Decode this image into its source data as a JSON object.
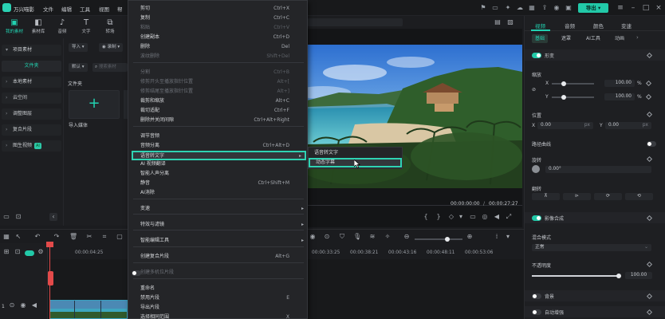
{
  "titlebar": {
    "app_name": "万兴喵影",
    "menus": [
      "文件",
      "编辑",
      "工具",
      "视图",
      "帮"
    ],
    "export_label": "导出"
  },
  "left_panel": {
    "tabs": [
      {
        "label": "我的素材",
        "icon": "media-icon"
      },
      {
        "label": "素材库",
        "icon": "library-icon"
      },
      {
        "label": "音频",
        "icon": "music-icon"
      },
      {
        "label": "文字",
        "icon": "text-icon"
      },
      {
        "label": "转场",
        "icon": "transition-icon"
      }
    ],
    "sidebar": [
      {
        "label": "项目素材",
        "kind": "section"
      },
      {
        "label": "文件夹",
        "kind": "folder"
      },
      {
        "label": "本地素材",
        "kind": "section"
      },
      {
        "label": "云空间",
        "kind": "section"
      },
      {
        "label": "调整图层",
        "kind": "section"
      },
      {
        "label": "复合片段",
        "kind": "section"
      },
      {
        "label": "图生视频",
        "kind": "section",
        "badge": "AI"
      }
    ],
    "import_button": "导入",
    "record_button": "录制",
    "sort_label": "默认",
    "search_placeholder": "搜索素材",
    "folder_title": "文件夹",
    "import_tile_label": "导入媒体"
  },
  "context_menu": {
    "items": [
      {
        "label": "剪切",
        "shortcut": "Ctrl+X",
        "disabled": false
      },
      {
        "label": "复制",
        "shortcut": "Ctrl+C",
        "disabled": false
      },
      {
        "label": "粘贴",
        "shortcut": "Ctrl+V",
        "disabled": true
      },
      {
        "label": "创建副本",
        "shortcut": "Ctrl+D",
        "disabled": false
      },
      {
        "label": "删除",
        "shortcut": "Del",
        "disabled": false
      },
      {
        "label": "波纹删除",
        "shortcut": "Shift+Del",
        "disabled": true
      },
      {
        "label": "分割",
        "shortcut": "Ctrl+B",
        "disabled": true
      },
      {
        "label": "修剪开头至播放指针位置",
        "shortcut": "Alt+[",
        "disabled": true
      },
      {
        "label": "修剪结尾至播放指针位置",
        "shortcut": "Alt+]",
        "disabled": true
      },
      {
        "label": "裁剪和缩放",
        "shortcut": "Alt+C",
        "disabled": false
      },
      {
        "label": "裁切适配",
        "shortcut": "Ctrl+F",
        "disabled": false
      },
      {
        "label": "删除并关闭间隙",
        "shortcut": "Ctrl+Alt+Right",
        "disabled": false
      },
      {
        "label": "调节音频",
        "shortcut": "",
        "disabled": false
      },
      {
        "label": "音频分离",
        "shortcut": "Ctrl+Alt+D",
        "disabled": false
      },
      {
        "label": "语音转文字",
        "shortcut": "",
        "disabled": false,
        "submenu": true
      },
      {
        "label": "AI 视频翻译",
        "shortcut": "",
        "disabled": false
      },
      {
        "label": "智能人声分离",
        "shortcut": "",
        "disabled": false
      },
      {
        "label": "静音",
        "shortcut": "Ctrl+Shift+M",
        "disabled": false
      },
      {
        "label": "AI消除",
        "shortcut": "",
        "disabled": false
      },
      {
        "label": "变速",
        "shortcut": "",
        "disabled": false,
        "submenu": true
      },
      {
        "label": "特效与滤镜",
        "shortcut": "",
        "disabled": false,
        "submenu": true
      },
      {
        "label": "智能编辑工具",
        "shortcut": "",
        "disabled": false,
        "submenu": true
      },
      {
        "label": "创建复合片段",
        "shortcut": "Alt+G",
        "disabled": false
      },
      {
        "label": "创建多机位片段",
        "shortcut": "",
        "disabled": true
      },
      {
        "label": "重命名",
        "shortcut": "",
        "disabled": false
      },
      {
        "label": "禁用片段",
        "shortcut": "E",
        "disabled": false
      },
      {
        "label": "导出片段",
        "shortcut": "",
        "disabled": false
      },
      {
        "label": "选择相同范围",
        "shortcut": "X",
        "disabled": false
      }
    ],
    "submenu": [
      "语音转文字",
      "动态字幕"
    ]
  },
  "player": {
    "current_time": "00:00:00:00",
    "total_time": "00:00:27:27"
  },
  "right_panel": {
    "tabs": [
      "视频",
      "音频",
      "颜色",
      "变速"
    ],
    "subtabs": [
      "基础",
      "遮罩",
      "AI工具",
      "动画"
    ],
    "transform": {
      "title": "形变",
      "scale_label": "缩放",
      "scale_x": "100.00",
      "scale_y": "100.00",
      "unit_percent": "%",
      "position_label": "位置",
      "pos_x": "0.00",
      "pos_y": "0.00",
      "unit_px": "px",
      "path_curve_label": "路径曲线",
      "rotate_label": "旋转",
      "rotate_value": "0.00°",
      "flip_label": "翻转"
    },
    "compositing": {
      "title": "影像合成",
      "blend_label": "混合模式",
      "blend_value": "正常",
      "opacity_label": "不透明度",
      "opacity_value": "100.00",
      "opacity_level": 1.0
    },
    "background_label": "背景",
    "auto_enhance_label": "自动增强"
  },
  "timeline": {
    "ticks": [
      "00:00:04:25",
      "00:00:33:25",
      "00:00:38:21",
      "00:00:43:16",
      "00:00:48:11",
      "00:00:53:06"
    ],
    "track_labels": [
      "1"
    ]
  },
  "colors": {
    "accent": "#22d1b0",
    "playhead": "#e34a4a"
  }
}
